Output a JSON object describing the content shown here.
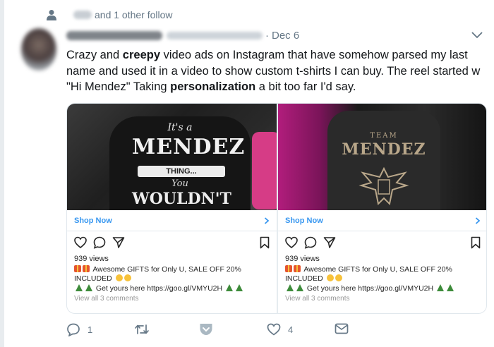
{
  "social_context": {
    "text": "and 1 other follow",
    "icon": "person-icon"
  },
  "tweet": {
    "dot": "·",
    "date": "Dec 6",
    "text_segments": [
      {
        "text": "Crazy and ",
        "bold": false
      },
      {
        "text": "creepy",
        "bold": true
      },
      {
        "text": " video ads on Instagram that have somehow parsed my last",
        "bold": false
      },
      {
        "text": "name and used it in a video to show custom t-shirts I can buy. The reel started w",
        "bold": false
      },
      {
        "text": "\"Hi Mendez\" Taking ",
        "bold": false
      },
      {
        "text": "personalization",
        "bold": true
      },
      {
        "text": " a bit too far I'd say.",
        "bold": false
      }
    ]
  },
  "ads": [
    {
      "shirt_text_top": "It's a",
      "shirt_text_main": "MENDEZ",
      "shirt_text_bottom": "THING...",
      "shirt_text_extra": "You",
      "shirt_text_extra2": "WOULDN'T",
      "shop_now": "Shop Now",
      "views": "939 views",
      "caption_line1": "Awesome GIFTS for Only U, SALE OFF 20% INCLUDED",
      "caption_line2": "Get yours here https://goo.gl/VMYU2H",
      "view_all": "View all 3 comments"
    },
    {
      "shirt_text_top": "TEAM",
      "shirt_text_main": "MENDEZ",
      "shop_now": "Shop Now",
      "views": "939 views",
      "caption_line1": "Awesome GIFTS for Only U, SALE OFF 20% INCLUDED",
      "caption_line2": "Get yours here https://goo.gl/VMYU2H",
      "view_all": "View all 3 comments"
    }
  ],
  "actions": {
    "reply_count": "1",
    "retweet_count": "",
    "like_count": "4"
  },
  "colors": {
    "accent": "#3897f0",
    "muted": "#657786",
    "text": "#14171a"
  }
}
